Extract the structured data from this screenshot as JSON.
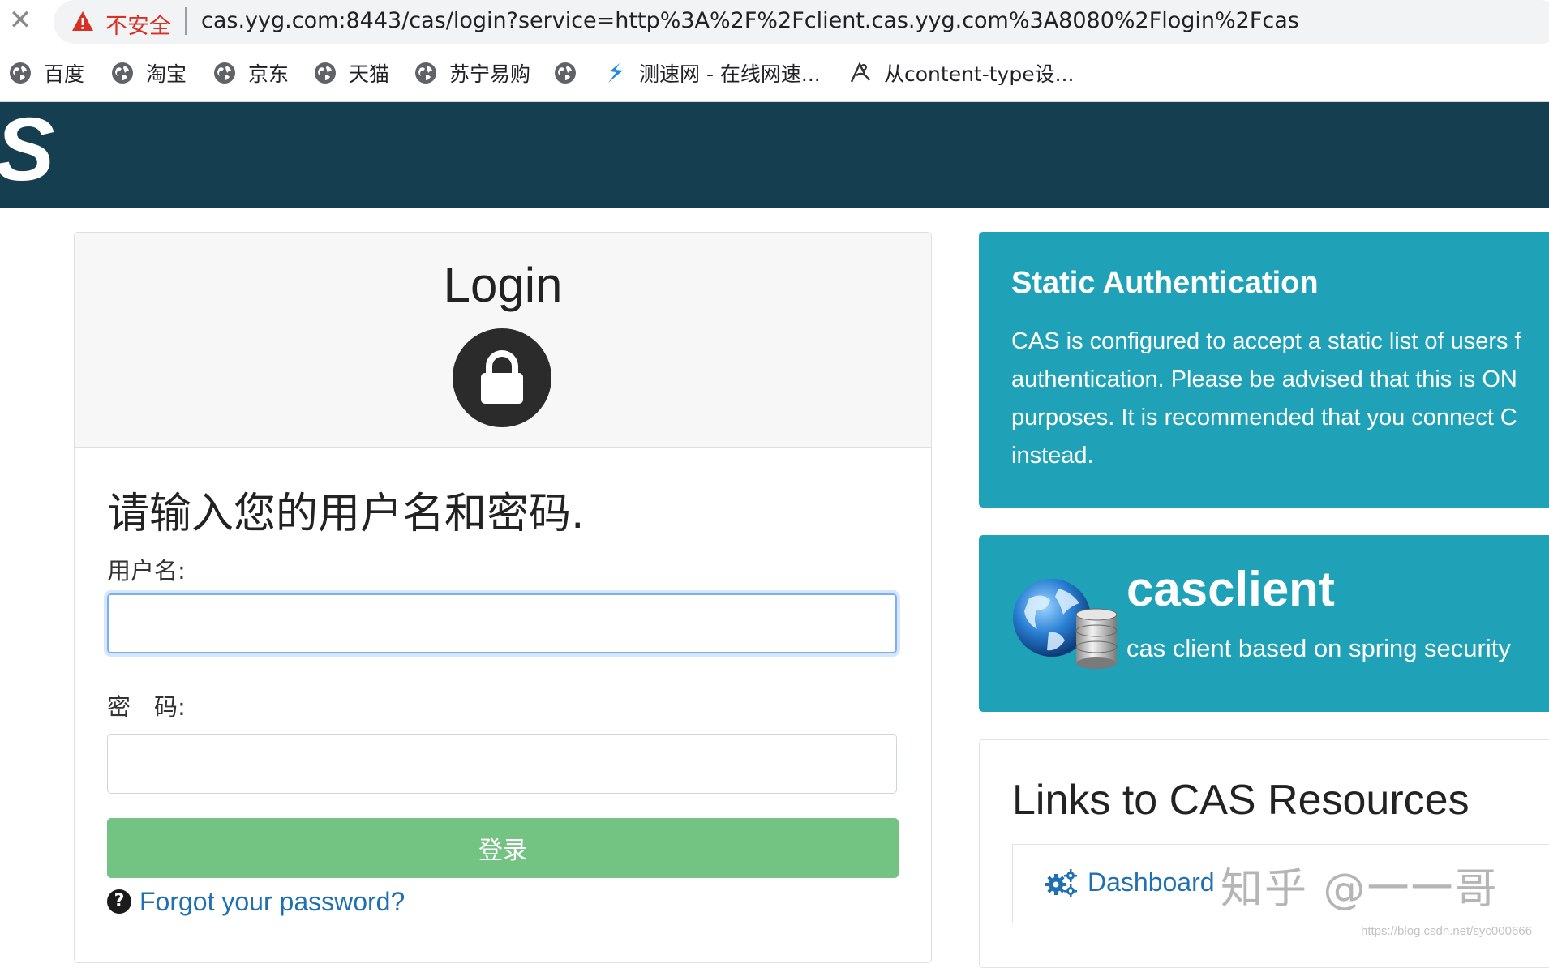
{
  "browser": {
    "insecure_label": "不安全",
    "url": "cas.yyg.com:8443/cas/login?service=http%3A%2F%2Fclient.cas.yyg.com%3A8080%2Flogin%2Fcas",
    "bookmarks": [
      {
        "label": "百度",
        "icon": "globe-icon"
      },
      {
        "label": "淘宝",
        "icon": "globe-icon"
      },
      {
        "label": "京东",
        "icon": "globe-icon"
      },
      {
        "label": "天猫",
        "icon": "globe-icon"
      },
      {
        "label": "苏宁易购",
        "icon": "globe-icon"
      },
      {
        "label": "",
        "icon": "globe-icon"
      },
      {
        "label": "测速网 - 在线网速...",
        "icon": "speedtest-icon"
      },
      {
        "label": "从content-type设...",
        "icon": "bookmark-site-icon"
      }
    ]
  },
  "header": {
    "logo_text": "S"
  },
  "login": {
    "title": "Login",
    "prompt": "请输入您的用户名和密码.",
    "username_label": "用户名:",
    "username_value": "",
    "password_label": "密　码:",
    "password_value": "",
    "submit_label": "登录",
    "forgot_label": "Forgot your password?"
  },
  "static_auth": {
    "title": "Static Authentication",
    "lines": [
      "CAS is configured to accept a static list of users f",
      "authentication. Please be advised that this is ON",
      "purposes. It is recommended that you connect C",
      "instead."
    ]
  },
  "client": {
    "name": "casclient",
    "description": "cas client based on spring security"
  },
  "links": {
    "title": "Links to CAS Resources",
    "items": [
      {
        "label": "Dashboard",
        "icon": "gears-icon"
      }
    ]
  },
  "watermarks": {
    "zhihu": "知乎 @一一哥",
    "csdn": "https://blog.csdn.net/syc000666"
  },
  "colors": {
    "header_bg": "#153e50",
    "panel_bg": "#1fa2b8",
    "button_bg": "#73c383",
    "link": "#1f6fb3",
    "insecure": "#d93025"
  }
}
